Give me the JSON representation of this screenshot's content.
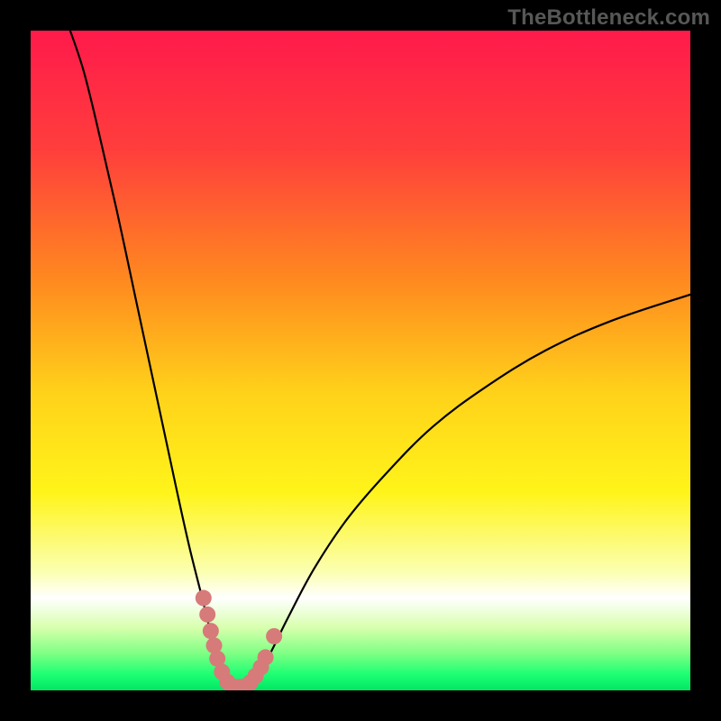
{
  "watermark": "TheBottleneck.com",
  "chart_data": {
    "type": "line",
    "title": "",
    "xlabel": "",
    "ylabel": "",
    "xlim": [
      0,
      100
    ],
    "ylim": [
      0,
      100
    ],
    "gradient_stops": [
      {
        "offset": 0.0,
        "color": "#ff1a4b"
      },
      {
        "offset": 0.18,
        "color": "#ff3e3c"
      },
      {
        "offset": 0.38,
        "color": "#ff8a1f"
      },
      {
        "offset": 0.55,
        "color": "#ffd21a"
      },
      {
        "offset": 0.7,
        "color": "#fff41a"
      },
      {
        "offset": 0.82,
        "color": "#fbffb0"
      },
      {
        "offset": 0.86,
        "color": "#ffffff"
      },
      {
        "offset": 0.905,
        "color": "#d8ffad"
      },
      {
        "offset": 0.945,
        "color": "#7cff83"
      },
      {
        "offset": 0.975,
        "color": "#1fff73"
      },
      {
        "offset": 1.0,
        "color": "#00e765"
      }
    ],
    "series": [
      {
        "name": "bottleneck-curve",
        "note": "V-shaped curve; y ≈ 0 at the minimum near x ≈ 31, rising toward 100 at x=0 and ~60 at x=100",
        "points": [
          {
            "x": 6.0,
            "y": 100.0
          },
          {
            "x": 8.0,
            "y": 94.0
          },
          {
            "x": 10.0,
            "y": 86.0
          },
          {
            "x": 13.0,
            "y": 73.0
          },
          {
            "x": 16.0,
            "y": 59.0
          },
          {
            "x": 19.0,
            "y": 45.0
          },
          {
            "x": 22.0,
            "y": 31.0
          },
          {
            "x": 24.0,
            "y": 22.0
          },
          {
            "x": 26.0,
            "y": 14.0
          },
          {
            "x": 27.5,
            "y": 8.0
          },
          {
            "x": 29.0,
            "y": 3.0
          },
          {
            "x": 30.5,
            "y": 0.5
          },
          {
            "x": 32.5,
            "y": 0.5
          },
          {
            "x": 34.0,
            "y": 2.0
          },
          {
            "x": 36.0,
            "y": 5.0
          },
          {
            "x": 39.0,
            "y": 11.0
          },
          {
            "x": 43.0,
            "y": 18.5
          },
          {
            "x": 48.0,
            "y": 26.0
          },
          {
            "x": 54.0,
            "y": 33.0
          },
          {
            "x": 61.0,
            "y": 40.0
          },
          {
            "x": 69.0,
            "y": 46.0
          },
          {
            "x": 78.0,
            "y": 51.5
          },
          {
            "x": 88.0,
            "y": 56.0
          },
          {
            "x": 100.0,
            "y": 60.0
          }
        ]
      }
    ],
    "markers": {
      "name": "highlight-dots",
      "color": "#d77a7a",
      "radius": 9,
      "points": [
        {
          "x": 26.2,
          "y": 14.0
        },
        {
          "x": 26.8,
          "y": 11.5
        },
        {
          "x": 27.3,
          "y": 9.0
        },
        {
          "x": 27.8,
          "y": 6.8
        },
        {
          "x": 28.3,
          "y": 4.8
        },
        {
          "x": 29.0,
          "y": 2.8
        },
        {
          "x": 29.8,
          "y": 1.3
        },
        {
          "x": 30.6,
          "y": 0.6
        },
        {
          "x": 31.5,
          "y": 0.5
        },
        {
          "x": 32.4,
          "y": 0.6
        },
        {
          "x": 33.3,
          "y": 1.2
        },
        {
          "x": 34.1,
          "y": 2.2
        },
        {
          "x": 34.9,
          "y": 3.5
        },
        {
          "x": 35.6,
          "y": 5.0
        },
        {
          "x": 36.9,
          "y": 8.2
        }
      ]
    }
  }
}
